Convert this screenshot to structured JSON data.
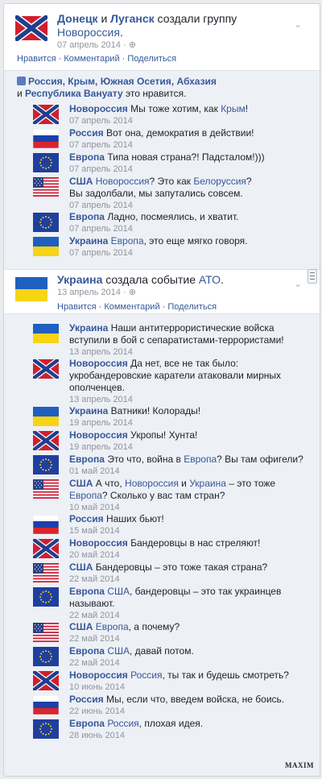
{
  "post1": {
    "author1": "Донецк",
    "and_word": "и",
    "author2": "Луганск",
    "action": "создали группу",
    "target": "Новороссия",
    "dot": ".",
    "date": "07 апрель 2014 ·",
    "actions": "Нравится · Комментарий · Поделиться"
  },
  "likes": {
    "names": "Россия, Крым, Южная Осетия, Абхазия",
    "and_word": "и",
    "last": "Республика Вануату",
    "suffix": "это нравится."
  },
  "comments1": [
    {
      "flag": "novorossiya",
      "name": "Новороссия",
      "text": "Мы тоже хотим, как ",
      "link": "Крым",
      "tail": "!",
      "date": "07 апрель 2014"
    },
    {
      "flag": "russia",
      "name": "Россия",
      "text": "Вот она, демократия в действии!",
      "date": "07 апрель 2014"
    },
    {
      "flag": "eu",
      "name": "Европа",
      "text": "Типа новая страна?! Падсталом!)))",
      "date": "07 апрель 2014"
    },
    {
      "flag": "usa",
      "name": "США",
      "link": "Новороссия",
      "text": "? Это как ",
      "link2": "Белоруссия",
      "tail": "?",
      "line2": "Вы задолбали, мы запутались совсем.",
      "date": "07 апрель 2014"
    },
    {
      "flag": "eu",
      "name": "Европа",
      "text": "Ладно, посмеялись, и хватит.",
      "date": "07 апрель 2014"
    },
    {
      "flag": "ukraine",
      "name": "Украина",
      "link": "Европа",
      "text": ", это еще мягко говоря.",
      "date": "07 апрель 2014"
    }
  ],
  "post2": {
    "author": "Украина",
    "action": "создала событие",
    "target": "АТО",
    "dot": ".",
    "date": "13 апрель 2014 ·",
    "actions": "Нравится · Комментарий · Поделиться"
  },
  "comments2": [
    {
      "flag": "ukraine",
      "name": "Украина",
      "text": "Наши антитеррористические войска",
      "line2": "вступили в бой с сепаратистами-террористами!",
      "date": "13 апрель 2014"
    },
    {
      "flag": "novorossiya",
      "name": "Новороссия",
      "text": "Да нет, все не так было:",
      "line2": "укробандеровские каратели атаковали мирных",
      "line3": "ополченцев.",
      "date": "13 апрель 2014"
    },
    {
      "flag": "ukraine",
      "name": "Украина",
      "text": "Ватники! Колорады!",
      "date": "19 апрель 2014"
    },
    {
      "flag": "novorossiya",
      "name": "Новороссия",
      "text": "Укропы! Хунта!",
      "date": "19 апрель 2014"
    },
    {
      "flag": "eu",
      "name": "Европа",
      "text": "Это что, война в ",
      "link": "Европа",
      "tail": "? Вы там офигели?",
      "date": "01 май 2014"
    },
    {
      "flag": "usa",
      "name": "США",
      "text": "А что, ",
      "link": "Новороссия",
      "mid": " и ",
      "link2": "Украина",
      "tail": " – это тоже",
      "line2link": "Европа",
      "line2": "? Сколько у вас там стран?",
      "date": "10 май 2014"
    },
    {
      "flag": "russia",
      "name": "Россия",
      "text": "Наших бьют!",
      "date": "15 май 2014"
    },
    {
      "flag": "novorossiya",
      "name": "Новороссия",
      "text": "Бандеровцы в нас стреляют!",
      "date": "20 май 2014"
    },
    {
      "flag": "usa",
      "name": "США",
      "text": "Бандеровцы – это тоже такая страна?",
      "date": "22 май 2014"
    },
    {
      "flag": "eu",
      "name": "Европа",
      "link": "США",
      "text": ", бандеровцы – это так украинцев",
      "line2": "называют.",
      "date": "22 май 2014"
    },
    {
      "flag": "usa",
      "name": "США",
      "link": "Европа",
      "text": ", а почему?",
      "date": "22 май 2014"
    },
    {
      "flag": "eu",
      "name": "Европа",
      "link": "США",
      "text": ", давай потом.",
      "date": "22 май 2014"
    },
    {
      "flag": "novorossiya",
      "name": "Новороссия",
      "link": "Россия",
      "text": ", ты так и будешь смотреть?",
      "date": "10 июнь 2014"
    },
    {
      "flag": "russia",
      "name": "Россия",
      "text": "Мы, если что, введем войска, не боись.",
      "date": "22 июнь 2014"
    },
    {
      "flag": "eu",
      "name": "Европа",
      "link": "Россия",
      "text": ", плохая идея.",
      "date": "28 июнь 2014"
    }
  ],
  "watermark": "MAXIM",
  "icons": {
    "chevron": "chevron-down-icon",
    "globe": "globe-icon",
    "like": "thumbs-up-icon",
    "scroll": "scrollbar-handle"
  },
  "colors": {
    "link": "#365899",
    "date": "#90949c",
    "background": "#edf0f5"
  }
}
